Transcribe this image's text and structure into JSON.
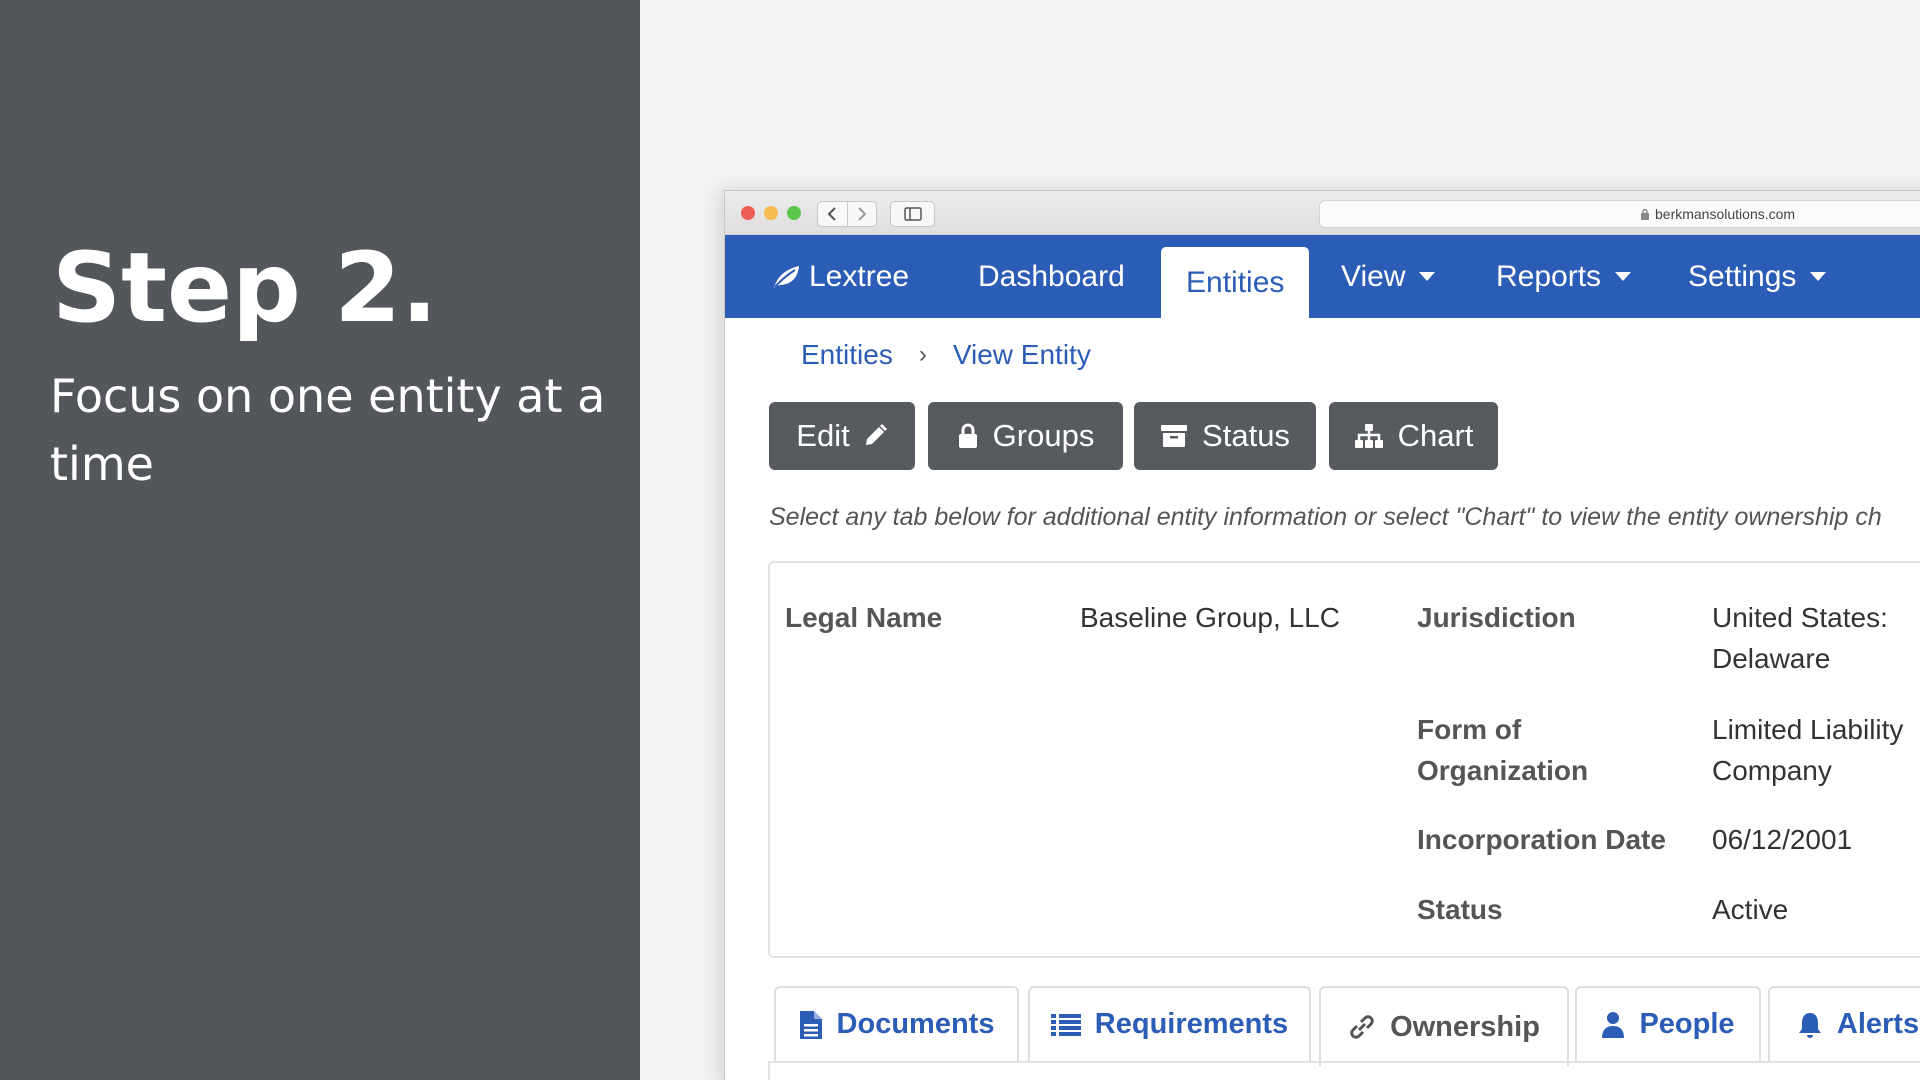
{
  "slide": {
    "title": "Step 2.",
    "subtitle": "Focus on one entity at a time"
  },
  "browser": {
    "url": "berkmansolutions.com"
  },
  "nav": {
    "brand": "Lextree",
    "dashboard": "Dashboard",
    "entities": "Entities",
    "view": "View",
    "reports": "Reports",
    "settings": "Settings"
  },
  "breadcrumb": {
    "first": "Entities",
    "second": "View Entity"
  },
  "actions": {
    "edit": "Edit",
    "groups": "Groups",
    "status": "Status",
    "chart": "Chart"
  },
  "hint": "Select any tab below for additional entity information or select \"Chart\" to view the entity ownership ch",
  "entity": {
    "legal_name_label": "Legal Name",
    "legal_name": "Baseline Group, LLC",
    "jurisdiction_label": "Jurisdiction",
    "jurisdiction_line1": "United States:",
    "jurisdiction_line2": "Delaware",
    "form_label_line1": "Form of",
    "form_label_line2": "Organization",
    "form_line1": "Limited Liability",
    "form_line2": "Company",
    "incorporation_label": "Incorporation Date",
    "incorporation_date": "06/12/2001",
    "status_label": "Status",
    "status": "Active"
  },
  "tabs": {
    "documents": "Documents",
    "requirements": "Requirements",
    "ownership": "Ownership",
    "people": "People",
    "alerts": "Alerts"
  },
  "colors": {
    "brand_blue": "#2b5cb6",
    "button_gray": "#575b60",
    "panel_gray": "#53575b"
  }
}
